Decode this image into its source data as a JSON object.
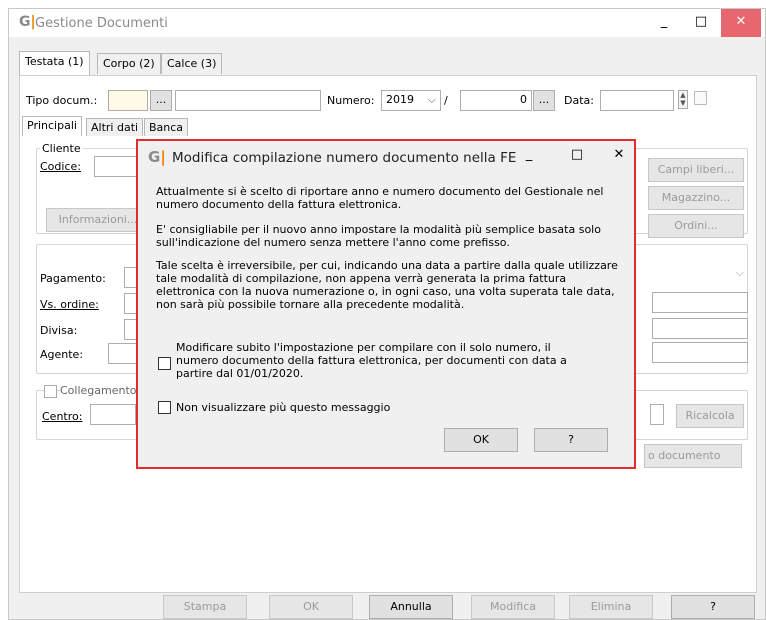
{
  "window": {
    "title": "Gestione Documenti",
    "logo_letter": "G",
    "minimize": "_",
    "maximize": "□",
    "close": "✕"
  },
  "top_tabs": [
    "Testata (1)",
    "Corpo (2)",
    "Calce (3)"
  ],
  "header_row": {
    "tipo_label": "Tipo docum.:",
    "ellipsis": "...",
    "numero_label": "Numero:",
    "year": "2019",
    "slash": "/",
    "number": "0",
    "data_label": "Data:"
  },
  "sub_tabs": [
    "Principali",
    "Altri dati",
    "Banca"
  ],
  "cliente": {
    "group_label": "Cliente",
    "codice_label": "Codice:",
    "informazioni_button": "Informazioni..."
  },
  "right_buttons": [
    "Campi liberi...",
    "Magazzino...",
    "Ordini..."
  ],
  "pagamento": {
    "pagamento_label": "Pagamento:",
    "vs_ordine_label": "Vs. ordine:",
    "divisa_label": "Divisa:",
    "agente_label": "Agente:"
  },
  "collegamento": {
    "label": "Collegamento",
    "centro_label": "Centro:",
    "ricalcola_button": "Ricalcola",
    "documento_button": "o documento"
  },
  "bottom_buttons": [
    "Stampa",
    "OK",
    "Annulla",
    "Modifica",
    "Elimina",
    "?"
  ],
  "dialog": {
    "title": "Modifica compilazione numero documento nella FE",
    "minimize": "_",
    "maximize": "□",
    "close": "✕",
    "paragraph1": "Attualmente si è scelto di riportare anno e numero documento del Gestionale nel numero documento della fattura elettronica.",
    "paragraph2": "E' consigliabile per il nuovo anno impostare la modalità più semplice basata solo sull'indicazione del numero senza mettere l'anno come prefisso.",
    "paragraph3": "Tale scelta è irreversibile, per cui, indicando una data a partire dalla quale utilizzare tale modalità di compilazione, non appena verrà generata la prima fattura elettronica con la nuova numerazione o, in ogni caso, una volta superata tale data, non sarà più possibile tornare alla precedente modalità.",
    "checkbox1": "Modificare subito l'impostazione per compilare con il solo numero, il numero documento della fattura elettronica, per documenti con data a partire dal 01/01/2020.",
    "checkbox2": "Non visualizzare più questo messaggio",
    "ok_button": "OK",
    "help_button": "?"
  }
}
